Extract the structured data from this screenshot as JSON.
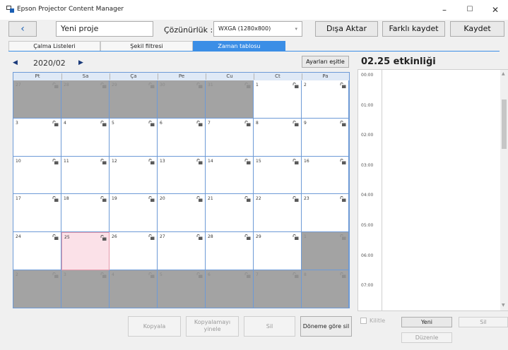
{
  "window": {
    "title": "Epson Projector Content Manager",
    "minimize": "–",
    "maximize": "☐",
    "close": "✕"
  },
  "toolbar": {
    "back": "‹",
    "project_name": "Yeni proje",
    "resolution_label": "Çözünürlük :",
    "resolution_value": "WXGA (1280x800)",
    "export_label": "Dışa Aktar",
    "save_as_label": "Farklı kaydet",
    "save_label": "Kaydet"
  },
  "tabs": [
    "Çalma Listeleri",
    "Şekil filtresi",
    "Zaman tablosu"
  ],
  "active_tab": "Zaman tablosu",
  "calendar": {
    "month": "2020/02",
    "prev": "◀",
    "next": "▶",
    "sync_label": "Ayarları eşitle",
    "weekdays": [
      "Pt",
      "Sa",
      "Ça",
      "Pe",
      "Cu",
      "Ct",
      "Pa"
    ],
    "weeks": [
      [
        "27",
        "28",
        "29",
        "30",
        "31",
        "1",
        "2"
      ],
      [
        "3",
        "4",
        "5",
        "6",
        "7",
        "8",
        "9"
      ],
      [
        "10",
        "11",
        "12",
        "13",
        "14",
        "15",
        "16"
      ],
      [
        "17",
        "18",
        "19",
        "20",
        "21",
        "22",
        "23"
      ],
      [
        "24",
        "25",
        "26",
        "27",
        "28",
        "29",
        "1"
      ],
      [
        "2",
        "3",
        "4",
        "5",
        "6",
        "7",
        "8"
      ]
    ],
    "selected_day": "25"
  },
  "bottom_buttons": {
    "copy": "Kopyala",
    "repeat_line1": "Kopyalamayı",
    "repeat_line2": "yinele",
    "delete": "Sil",
    "period_delete": "Döneme göre sil"
  },
  "events": {
    "title": "02.25 etkinliği",
    "hours": [
      "00:00",
      "01:00",
      "02:00",
      "03:00",
      "04:00",
      "05:00",
      "06:00",
      "07:00"
    ],
    "lock_label": "Kilitle",
    "new_label": "Yeni",
    "delete_label": "Sil",
    "edit_label": "Düzenle"
  }
}
